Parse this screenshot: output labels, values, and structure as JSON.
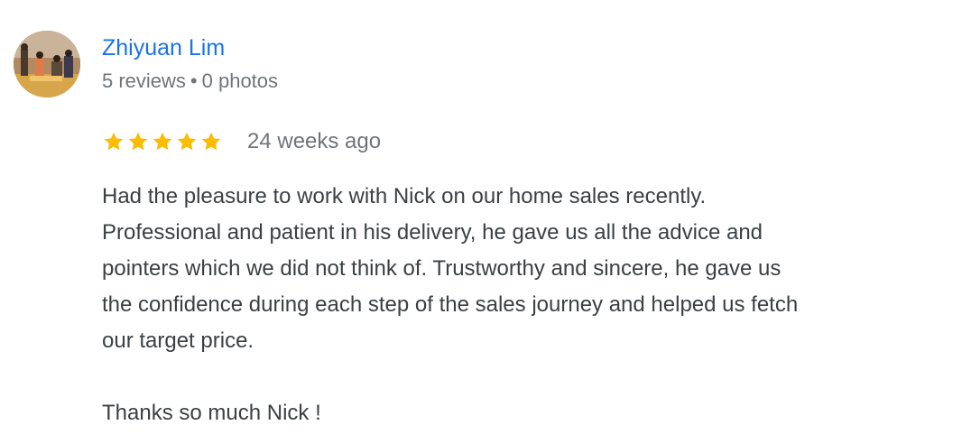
{
  "review": {
    "author": {
      "name": "Zhiyuan Lim",
      "reviews_count": "5 reviews",
      "separator": "•",
      "photos_count": "0 photos",
      "avatar_icon": "user-photo-avatar"
    },
    "rating": {
      "stars": 5,
      "max": 5,
      "star_color": "#fbbc04",
      "star_icon": "star-icon"
    },
    "time": "24 weeks ago",
    "body_lines": [
      "Had the pleasure to work with Nick on our home sales recently.",
      "Professional and patient in his delivery, he gave us all the advice and",
      "pointers which we did not think of. Trustworthy and sincere, he gave us",
      "the confidence during each step of the sales journey and helped us fetch",
      "our target price."
    ],
    "closing": "Thanks so much Nick !"
  },
  "colors": {
    "name_link": "#1a73e8",
    "meta_text": "#70757a",
    "body_text": "#3c4043"
  }
}
